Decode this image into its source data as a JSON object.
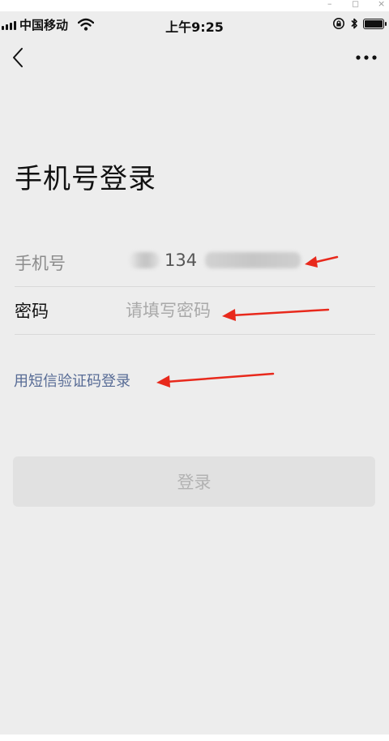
{
  "window_controls": {
    "minimize": "–",
    "maximize": "◻",
    "close": "×"
  },
  "status_bar": {
    "carrier": "中国移动",
    "time": "上午9:25"
  },
  "nav": {
    "back_icon": "chevron-left-icon",
    "more_icon": "more-dots-icon"
  },
  "page": {
    "title": "手机号登录"
  },
  "form": {
    "phone": {
      "label": "手机号",
      "value_visible": "134"
    },
    "password": {
      "label": "密码",
      "placeholder": "请填写密码"
    },
    "sms_login_link": "用短信验证码登录",
    "submit_label": "登录"
  },
  "colors": {
    "background": "#ededed",
    "link": "#576b95",
    "button_disabled_bg": "#e1e1e1",
    "button_disabled_text": "#b2b2b2",
    "annotation_arrow": "#e8291c"
  }
}
